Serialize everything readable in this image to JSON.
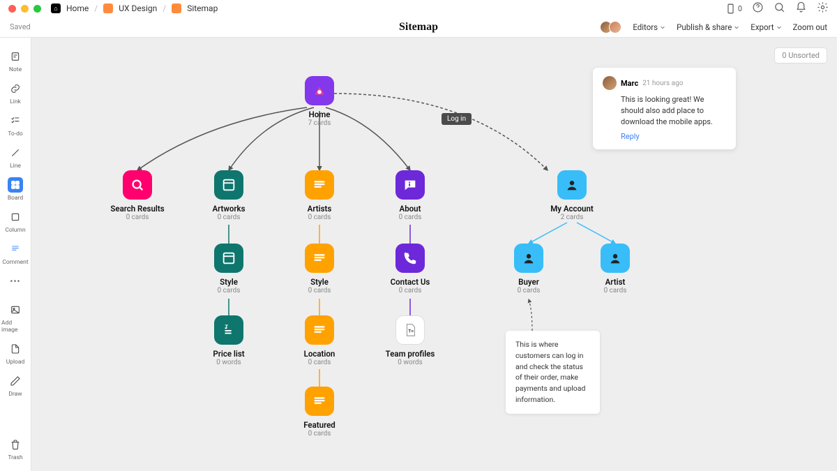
{
  "titlebar": {
    "breadcrumbs": [
      "Home",
      "UX Design",
      "Sitemap"
    ],
    "notif_count": "0"
  },
  "header": {
    "saved": "Saved",
    "title": "Sitemap",
    "menu_editors": "Editors",
    "menu_publish": "Publish & share",
    "menu_export": "Export",
    "menu_zoom": "Zoom out"
  },
  "toolbar": {
    "note": "Note",
    "link": "Link",
    "todo": "To-do",
    "line": "Line",
    "board": "Board",
    "column": "Column",
    "comment": "Comment",
    "more": "•••",
    "addimage": "Add image",
    "upload": "Upload",
    "draw": "Draw",
    "trash": "Trash"
  },
  "unsorted": "0 Unsorted",
  "nodes": {
    "home": {
      "title": "Home",
      "sub": "7 cards"
    },
    "search": {
      "title": "Search Results",
      "sub": "0 cards"
    },
    "artworks": {
      "title": "Artworks",
      "sub": "0 cards"
    },
    "artists": {
      "title": "Artists",
      "sub": "0 cards"
    },
    "about": {
      "title": "About",
      "sub": "0 cards"
    },
    "account": {
      "title": "My Account",
      "sub": "2 cards"
    },
    "style1": {
      "title": "Style",
      "sub": "0 cards"
    },
    "style2": {
      "title": "Style",
      "sub": "0 cards"
    },
    "contact": {
      "title": "Contact Us",
      "sub": "0 cards"
    },
    "buyer": {
      "title": "Buyer",
      "sub": "0 cards"
    },
    "artist": {
      "title": "Artist",
      "sub": "0 cards"
    },
    "pricelist": {
      "title": "Price list",
      "sub": "0 words"
    },
    "location": {
      "title": "Location",
      "sub": "0 cards"
    },
    "team": {
      "title": "Team profiles",
      "sub": "0 words"
    },
    "featured": {
      "title": "Featured",
      "sub": "0 cards"
    }
  },
  "edge_label": "Log in",
  "comment": {
    "name": "Marc",
    "time": "21 hours ago",
    "body": "This is looking great! We should also add place to download the mobile apps.",
    "reply": "Reply"
  },
  "annotation": "This is where customers can log in and check the status of their order, make payments and upload information."
}
